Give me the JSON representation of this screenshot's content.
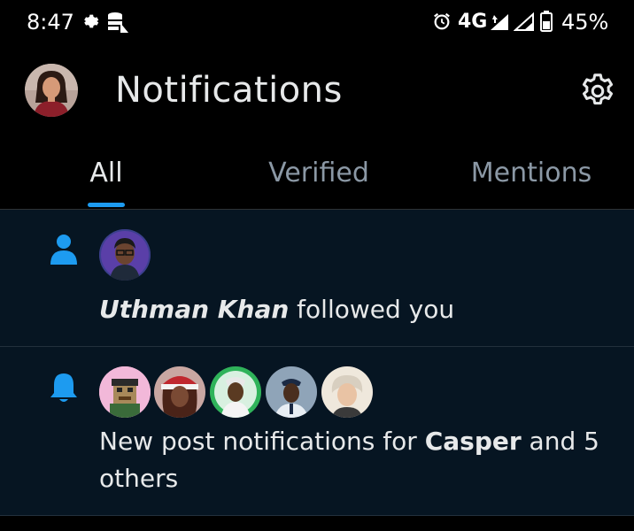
{
  "status_bar": {
    "time": "8:47",
    "network": "4G",
    "battery": "45%"
  },
  "header": {
    "title": "Notifications"
  },
  "tabs": [
    {
      "label": "All",
      "active": true
    },
    {
      "label": "Verified",
      "active": false
    },
    {
      "label": "Mentions",
      "active": false
    }
  ],
  "notifications": [
    {
      "type": "follow",
      "icon": "person-icon",
      "actor": "Uthman Khan",
      "text": "followed you"
    },
    {
      "type": "new-post-notifications",
      "icon": "bell-icon",
      "text_prefix": "New post notifications for ",
      "actor": "Casper",
      "text_suffix": " and 5 others"
    }
  ],
  "colors": {
    "accent": "#1d9bf0",
    "background": "#000000",
    "notification_bg": "#061522",
    "text": "#e7e9ea",
    "muted": "#8b98a5"
  }
}
